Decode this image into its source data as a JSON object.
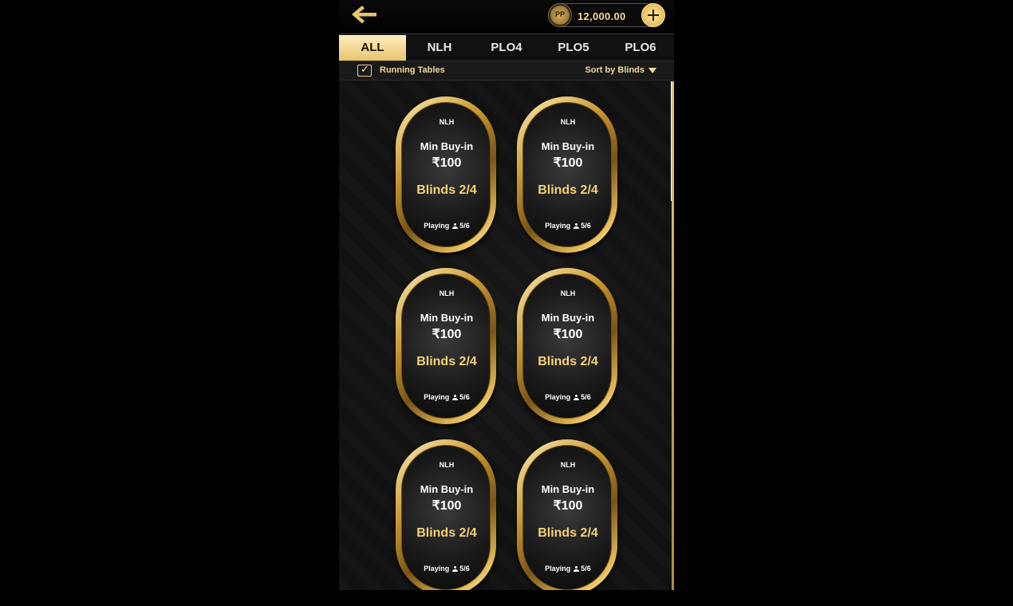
{
  "header": {
    "balance": "12,000.00",
    "coin_label": "PP"
  },
  "tabs": [
    "ALL",
    "NLH",
    "PLO4",
    "PLO5",
    "PLO6"
  ],
  "active_tab": "ALL",
  "filters": {
    "running_tables_label": "Running Tables",
    "running_checked": true,
    "sort_label": "Sort by Blinds"
  },
  "tables": [
    {
      "type": "NLH",
      "min_buyin_label": "Min Buy-in",
      "amount": "₹100",
      "blinds": "Blinds 2/4",
      "playing_label": "Playing",
      "players": "5/6"
    },
    {
      "type": "NLH",
      "min_buyin_label": "Min Buy-in",
      "amount": "₹100",
      "blinds": "Blinds 2/4",
      "playing_label": "Playing",
      "players": "5/6"
    },
    {
      "type": "NLH",
      "min_buyin_label": "Min Buy-in",
      "amount": "₹100",
      "blinds": "Blinds 2/4",
      "playing_label": "Playing",
      "players": "5/6"
    },
    {
      "type": "NLH",
      "min_buyin_label": "Min Buy-in",
      "amount": "₹100",
      "blinds": "Blinds 2/4",
      "playing_label": "Playing",
      "players": "5/6"
    },
    {
      "type": "NLH",
      "min_buyin_label": "Min Buy-in",
      "amount": "₹100",
      "blinds": "Blinds 2/4",
      "playing_label": "Playing",
      "players": "5/6"
    },
    {
      "type": "NLH",
      "min_buyin_label": "Min Buy-in",
      "amount": "₹100",
      "blinds": "Blinds 2/4",
      "playing_label": "Playing",
      "players": "5/6"
    }
  ],
  "colors": {
    "accent_gold": "#e7c46f",
    "dark_bg": "#111111"
  }
}
